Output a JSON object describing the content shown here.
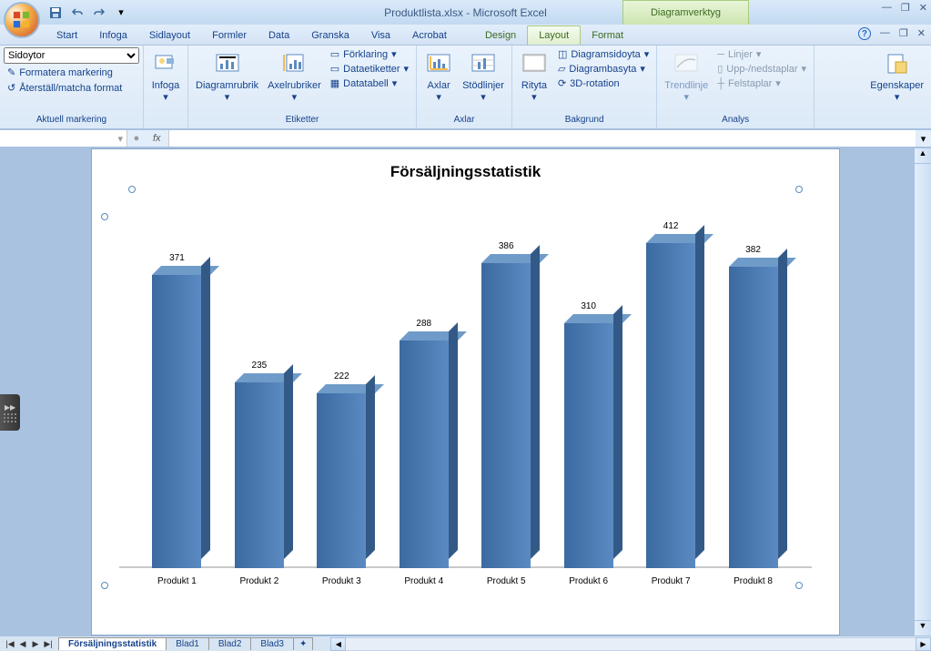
{
  "title_text": "Produktlista.xlsx - Microsoft Excel",
  "tool_tab": "Diagramverktyg",
  "tabs": [
    "Start",
    "Infoga",
    "Sidlayout",
    "Formler",
    "Data",
    "Granska",
    "Visa",
    "Acrobat"
  ],
  "ctx_tabs": [
    "Design",
    "Layout",
    "Format"
  ],
  "active_tab": "Layout",
  "selection_dropdown": "Sidoytor",
  "selection_btn1": "Formatera markering",
  "selection_btn2": "Återställ/matcha format",
  "group_selection": "Aktuell markering",
  "btn_insert": "Infoga",
  "btn_chart_title": "Diagramrubrik",
  "btn_axis_titles": "Axelrubriker",
  "btn_legend": "Förklaring",
  "btn_data_labels": "Dataetiketter",
  "btn_data_table": "Datatabell",
  "group_labels": "Etiketter",
  "btn_axes": "Axlar",
  "btn_gridlines": "Stödlinjer",
  "group_axes": "Axlar",
  "btn_plot_area": "Rityta",
  "btn_chart_wall": "Diagramsidoyta",
  "btn_chart_floor": "Diagrambasyta",
  "btn_3d_rotation": "3D-rotation",
  "group_background": "Bakgrund",
  "btn_trendline": "Trendlinje",
  "btn_lines": "Linjer",
  "btn_updown": "Upp-/nedstaplar",
  "btn_errorbars": "Felstaplar",
  "group_analysis": "Analys",
  "btn_properties": "Egenskaper",
  "sheet_tabs": [
    "Försäljningsstatistik",
    "Blad1",
    "Blad2",
    "Blad3"
  ],
  "chart_data": {
    "type": "bar",
    "title": "Försäljningsstatistik",
    "categories": [
      "Produkt 1",
      "Produkt 2",
      "Produkt 3",
      "Produkt 4",
      "Produkt 5",
      "Produkt 6",
      "Produkt 7",
      "Produkt 8"
    ],
    "values": [
      371,
      235,
      222,
      288,
      386,
      310,
      412,
      382
    ],
    "xlabel": "",
    "ylabel": "",
    "ylim": [
      0,
      450
    ]
  }
}
